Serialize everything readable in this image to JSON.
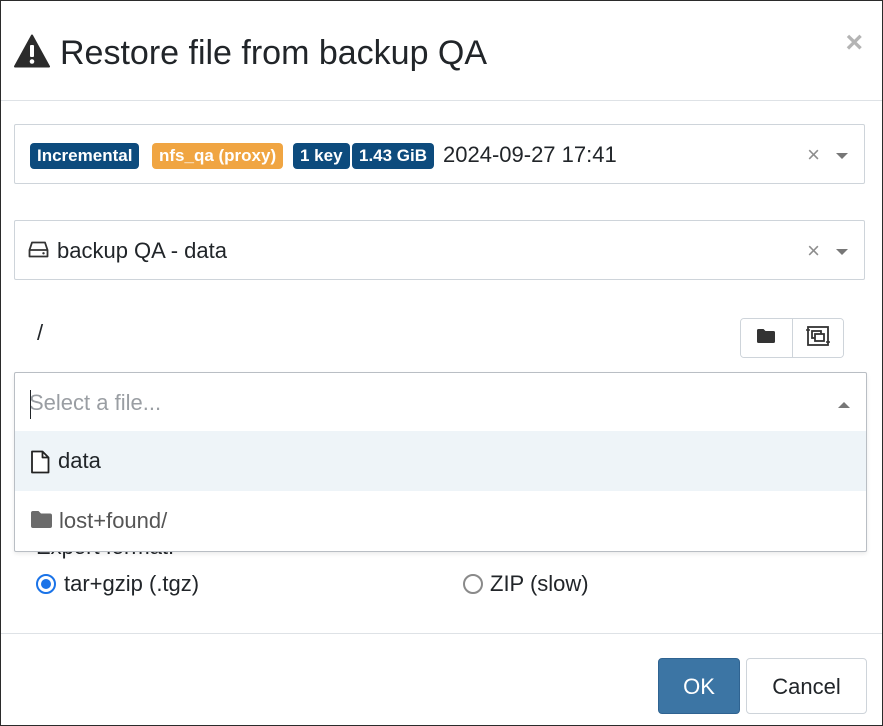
{
  "dialog": {
    "title": "Restore file from backup QA",
    "close_label": "×"
  },
  "snapshot": {
    "badges": [
      {
        "text": "Incremental",
        "color": "#0d4b7d"
      },
      {
        "text": "nfs_qa (proxy)",
        "color": "#f0a542"
      },
      {
        "text": "1 key",
        "color": "#0d4b7d"
      },
      {
        "text": "1.43 GiB",
        "color": "#0d4b7d"
      }
    ],
    "date": "2024-09-27 17:41",
    "clear_label": "×"
  },
  "datastore": {
    "label": "backup QA - data",
    "clear_label": "×"
  },
  "path": "/",
  "file_select": {
    "placeholder": "Select a file...",
    "options": [
      {
        "label": "data",
        "icon": "file-icon"
      },
      {
        "label": "lost+found/",
        "icon": "folder-icon"
      }
    ]
  },
  "export": {
    "label": "Export format:",
    "options": [
      {
        "label": "tar+gzip (.tgz)",
        "selected": true
      },
      {
        "label": "ZIP (slow)",
        "selected": false
      }
    ]
  },
  "footer": {
    "ok_label": "OK",
    "cancel_label": "Cancel"
  }
}
